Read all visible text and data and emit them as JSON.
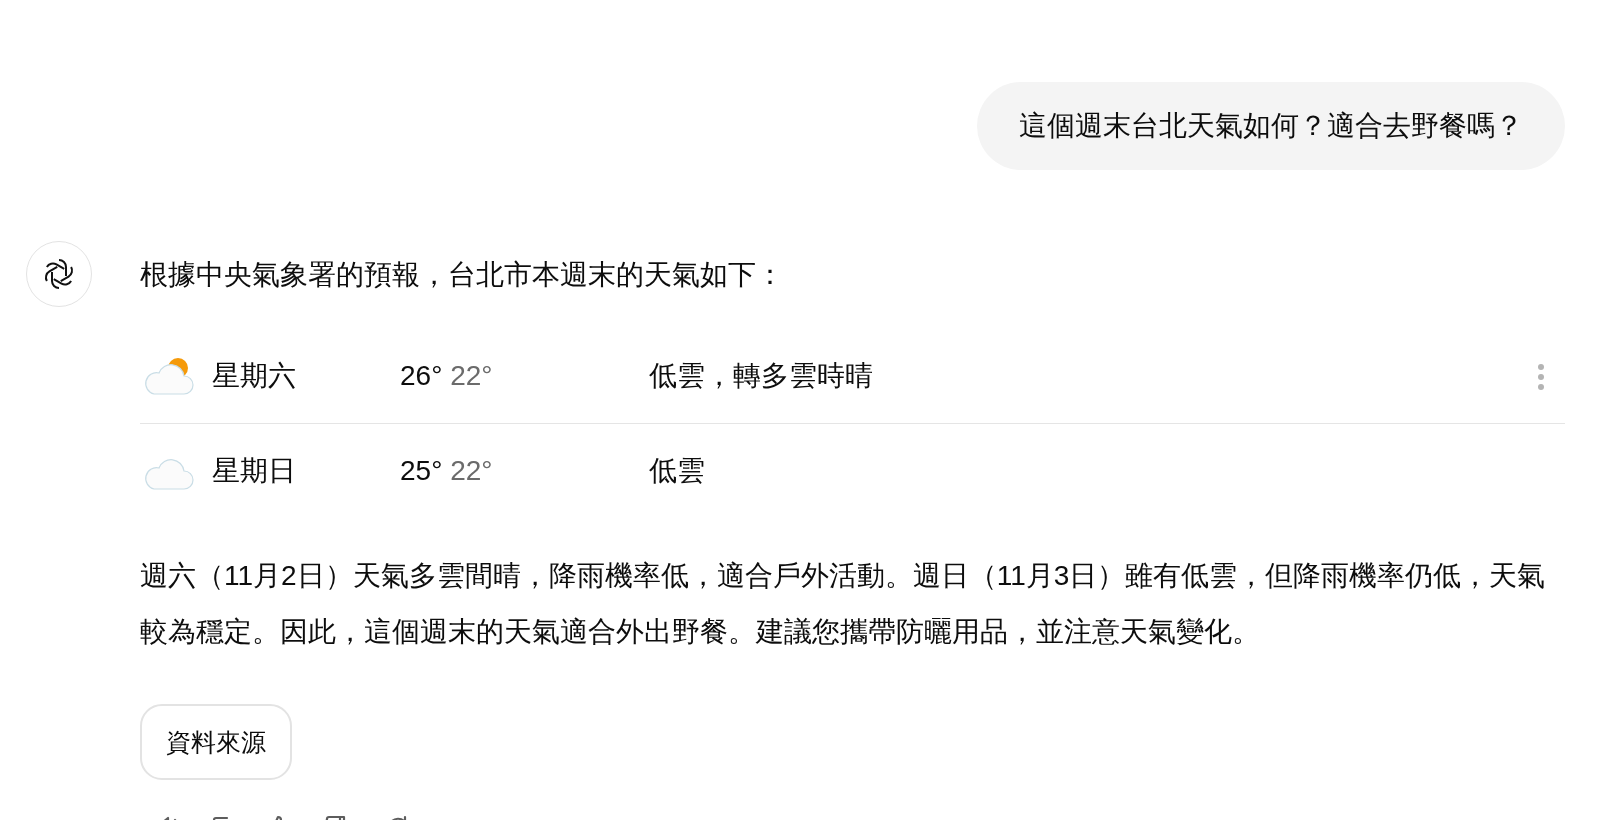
{
  "user_message": "這個週末台北天氣如何？適合去野餐嗎？",
  "assistant": {
    "intro": "根據中央氣象署的預報，台北市本週末的天氣如下：",
    "weather": [
      {
        "kind": "partly-cloudy",
        "day": "星期六",
        "high": "26°",
        "low": "22°",
        "condition": "低雲，轉多雲時晴"
      },
      {
        "kind": "cloudy",
        "day": "星期日",
        "high": "25°",
        "low": "22°",
        "condition": "低雲"
      }
    ],
    "paragraph": "週六（11月2日）天氣多雲間晴，降雨機率低，適合戶外活動。週日（11月3日）雖有低雲，但降雨機率仍低，天氣較為穩定。因此，這個週末的天氣適合外出野餐。建議您攜帶防曬用品，並注意天氣變化。",
    "sources_button": "資料來源"
  }
}
